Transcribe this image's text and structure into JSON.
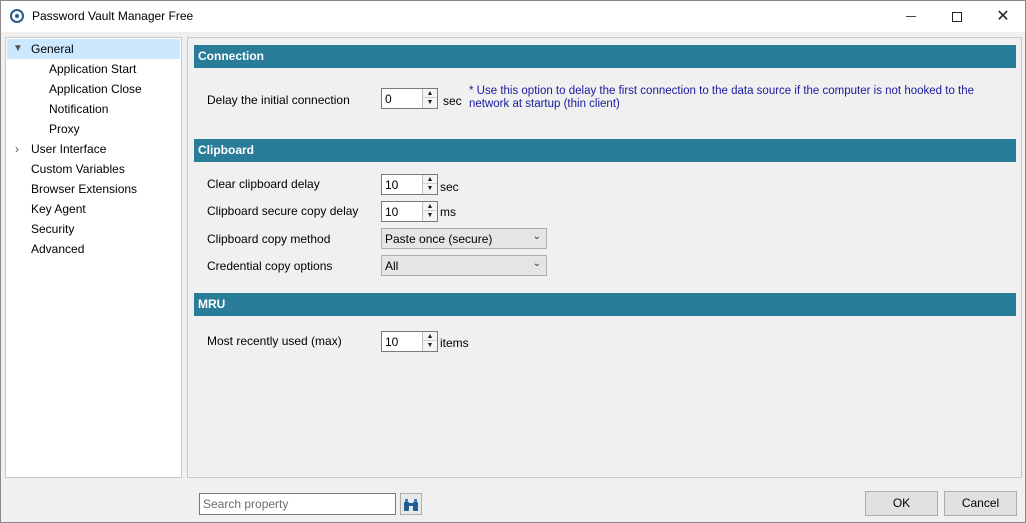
{
  "window": {
    "title": "Password Vault Manager Free"
  },
  "tree": {
    "items": [
      {
        "label": "General",
        "expanded": true,
        "selected": true
      },
      {
        "label": "Application Start"
      },
      {
        "label": "Application Close"
      },
      {
        "label": "Notification"
      },
      {
        "label": "Proxy"
      },
      {
        "label": "User Interface",
        "expandable": true
      },
      {
        "label": "Custom Variables"
      },
      {
        "label": "Browser Extensions"
      },
      {
        "label": "Key Agent"
      },
      {
        "label": "Security"
      },
      {
        "label": "Advanced"
      }
    ]
  },
  "connection": {
    "header": "Connection",
    "delay_label": "Delay the initial connection",
    "delay_value": "0",
    "delay_unit": "sec",
    "hint": "* Use this option to delay the first connection to the data source if the computer is not hooked to the network at startup (thin client)"
  },
  "clipboard": {
    "header": "Clipboard",
    "clear_label": "Clear clipboard delay",
    "clear_value": "10",
    "clear_unit": "sec",
    "secure_label": "Clipboard secure copy delay",
    "secure_value": "10",
    "secure_unit": "ms",
    "method_label": "Clipboard copy method",
    "method_value": "Paste once (secure)",
    "cred_label": "Credential copy options",
    "cred_value": "All"
  },
  "mru": {
    "header": "MRU",
    "max_label": "Most recently used (max)",
    "max_value": "10",
    "max_unit": "items"
  },
  "footer": {
    "search_placeholder": "Search property",
    "ok_label": "OK",
    "cancel_label": "Cancel"
  },
  "colors": {
    "section_header": "#2a7d99",
    "selection": "#cce8ff",
    "hint": "#1a1a9c"
  },
  "icons": [
    "app-logo-icon",
    "minimize-icon",
    "maximize-icon",
    "close-icon",
    "chevron-down-icon",
    "chevron-right-icon",
    "binoculars-icon",
    "spin-up-icon",
    "spin-down-icon"
  ]
}
